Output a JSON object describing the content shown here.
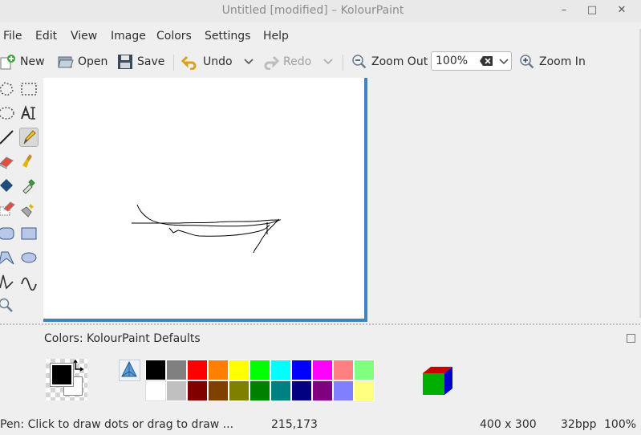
{
  "window": {
    "title": "Untitled [modified] – KolourPaint",
    "minimize": "–",
    "maximize": "□",
    "close": "✕"
  },
  "menu": [
    "File",
    "Edit",
    "View",
    "Image",
    "Colors",
    "Settings",
    "Help"
  ],
  "toolbar": {
    "new_label": "New",
    "open_label": "Open",
    "save_label": "Save",
    "undo_label": "Undo",
    "redo_label": "Redo",
    "zoom_out_label": "Zoom Out",
    "zoom_value": "100%",
    "zoom_in_label": "Zoom In"
  },
  "tools": [
    "free-form-selection",
    "rectangular-selection",
    "elliptical-selection",
    "text",
    "line",
    "pen",
    "eraser",
    "brush",
    "flood-fill",
    "color-picker",
    "color-eraser",
    "spraycan",
    "rounded-rectangle",
    "rectangle",
    "polygon",
    "ellipse",
    "connected-lines",
    "curve",
    "zoom"
  ],
  "colors_panel": {
    "title": "Colors: KolourPaint Defaults",
    "foreground": "#000000",
    "background": "#ffffff",
    "palette_row1": [
      "#000000",
      "#808080",
      "#ff0000",
      "#ff8000",
      "#ffff00",
      "#00ff00",
      "#00ffff",
      "#0000ff",
      "#ff00ff",
      "#ff8080",
      "#80ff80"
    ],
    "palette_row2": [
      "#ffffff",
      "#c0c0c0",
      "#800000",
      "#804000",
      "#808000",
      "#008000",
      "#008080",
      "#000080",
      "#800080",
      "#8080ff",
      "#ffff80"
    ]
  },
  "status": {
    "message": "Pen: Click to draw dots or drag to draw ...",
    "cursor": "215,173",
    "size": "400 x 300",
    "depth": "32bpp",
    "zoom": "100%"
  },
  "colors": {
    "canvas_border": "#3f82c4",
    "accent": "#3f82c4"
  }
}
